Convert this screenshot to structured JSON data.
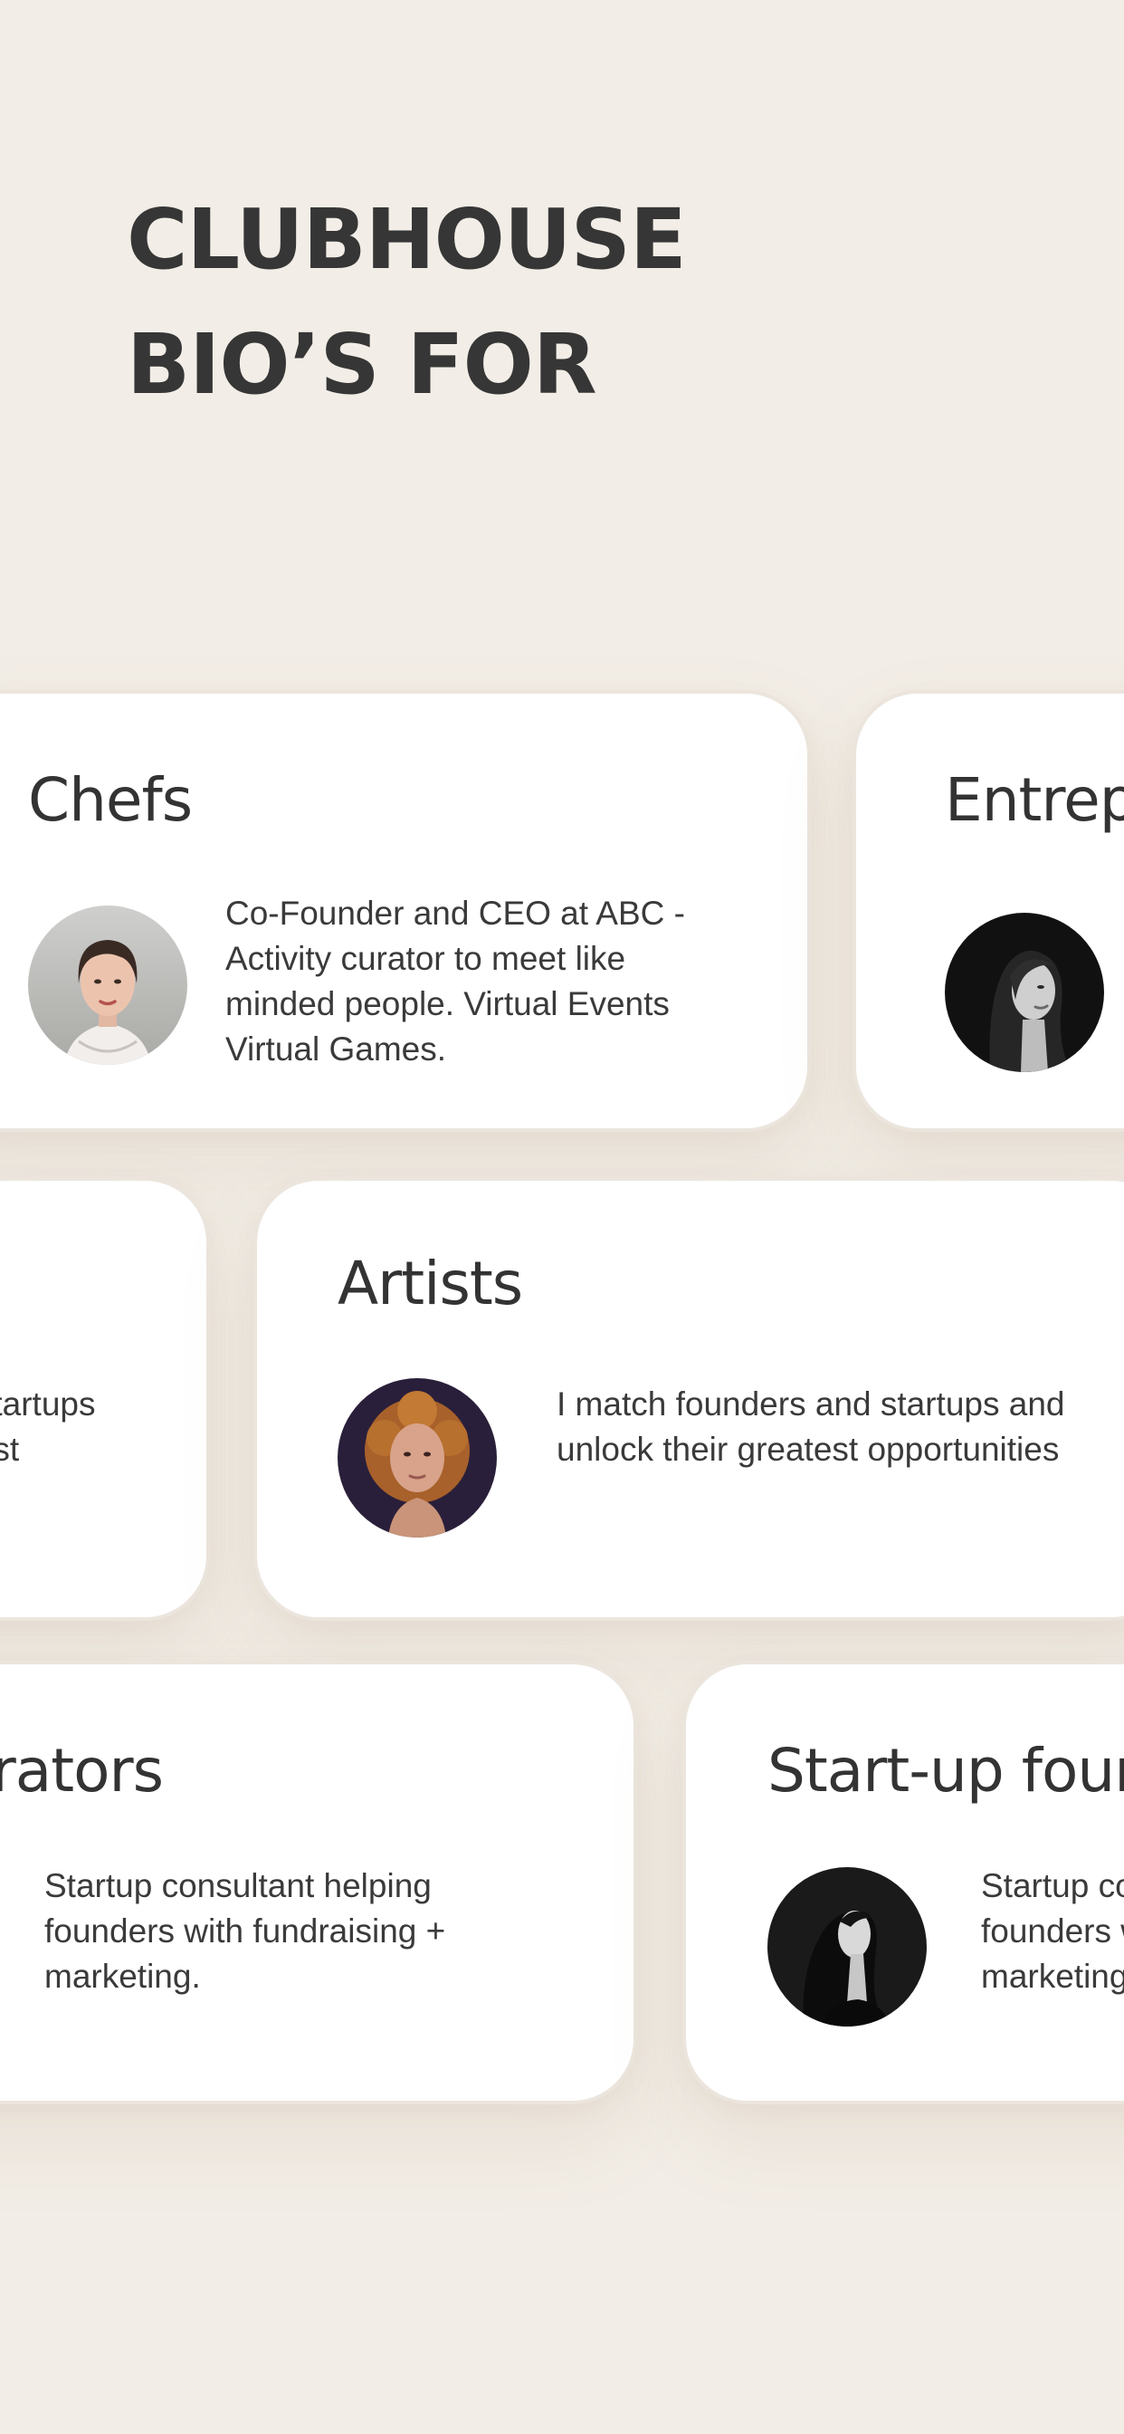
{
  "heading": {
    "line1": "CLUBHOUSE",
    "line2": "BIO’S FOR"
  },
  "cards": {
    "chefs": {
      "title": "Chefs",
      "bio": "Co-Founder and CEO at ABC - Activity curator to meet like minded people. Virtual Events Virtual Games."
    },
    "entrepreneurs": {
      "title": "Entrepreneurs"
    },
    "left_middle": {
      "bio": "I match founders and startups and unlock their greatest opportunities"
    },
    "artists": {
      "title": "Artists",
      "bio": "I match founders and startups and unlock their greatest opportunities"
    },
    "operators": {
      "title": "Operators",
      "bio": "Startup consultant helping founders with fundraising + marketing."
    },
    "startup_founders": {
      "title": "Start-up founders",
      "bio": "Startup consultant helping founders with fundraising + marketing."
    }
  },
  "colors": {
    "background": "#f2ede6",
    "card": "#ffffff",
    "text": "#333333"
  }
}
